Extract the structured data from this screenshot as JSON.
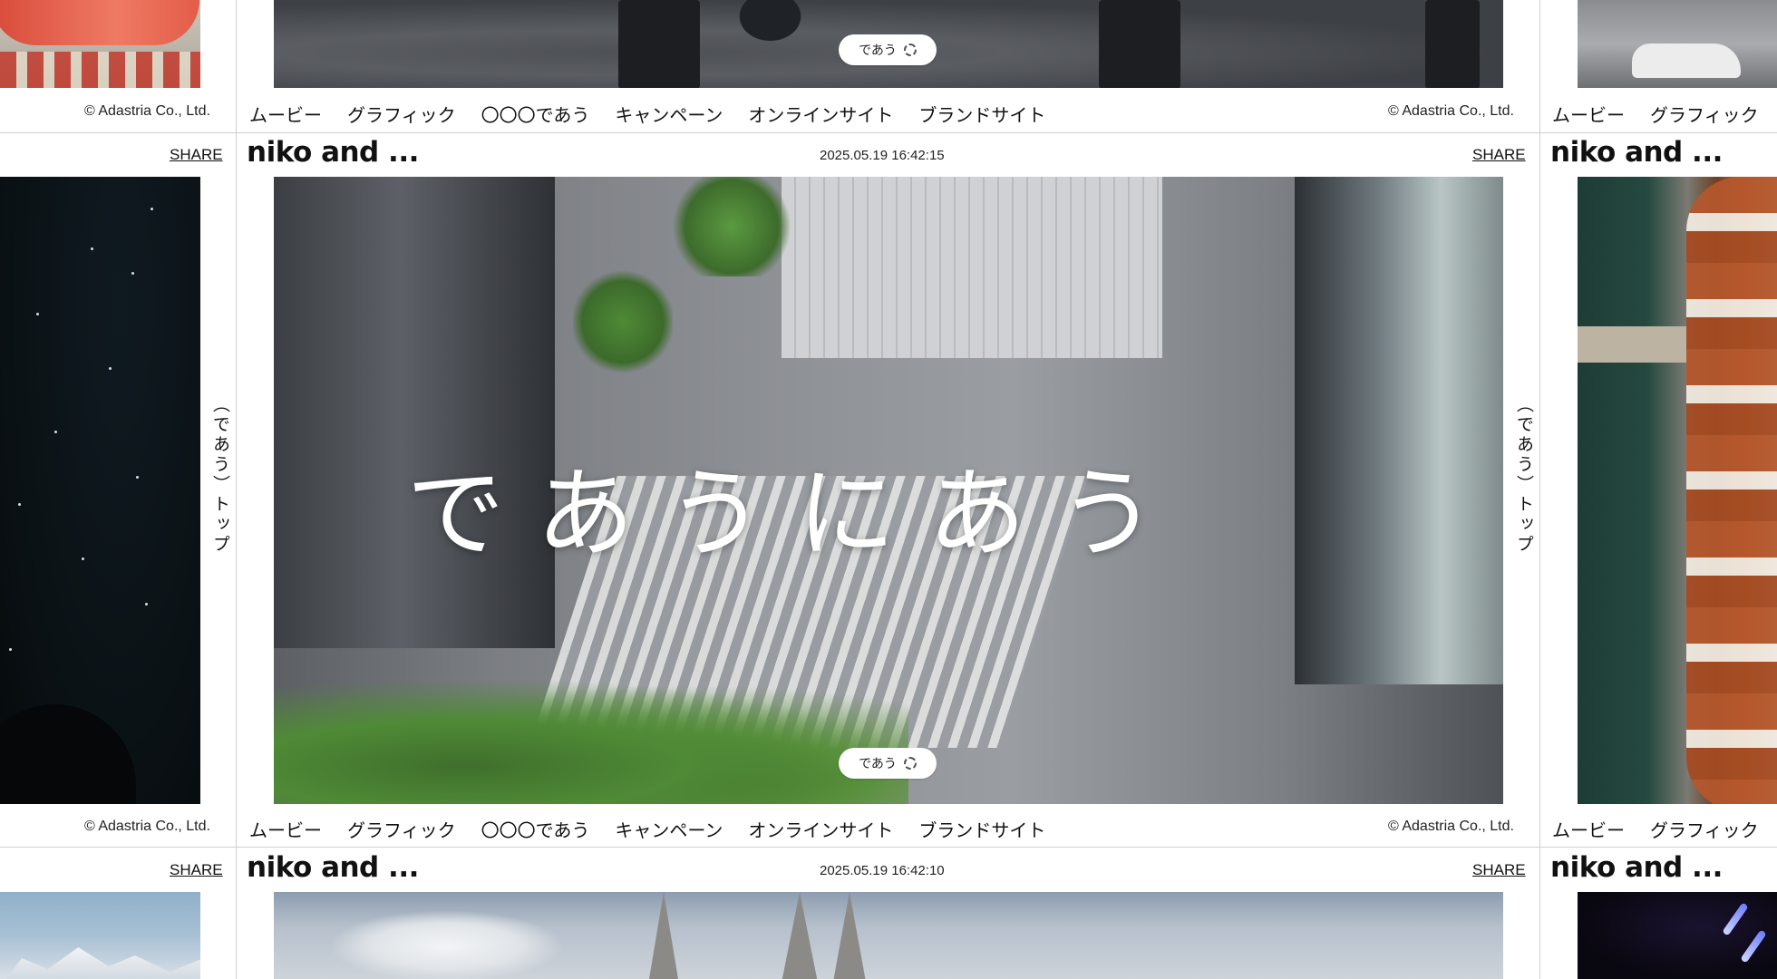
{
  "copyright": "© Adastria Co., Ltd.",
  "nav": [
    "ムービー",
    "グラフィック",
    "〇〇〇であう",
    "キャンペーン",
    "オンラインサイト",
    "ブランドサイト"
  ],
  "nav_partial": [
    "ムービー",
    "グラフィック"
  ],
  "brand": "niko and ...",
  "share_label": "SHARE",
  "side_link": "（であう）トップ",
  "pill_label": "であう",
  "overlay_text": "であうにあう",
  "posts": [
    {
      "timestamp": "2025.05.19  16:42:15"
    },
    {
      "timestamp": "2025.05.19  16:42:10"
    }
  ],
  "icons": {
    "spinner": "loading-spinner-icon"
  }
}
